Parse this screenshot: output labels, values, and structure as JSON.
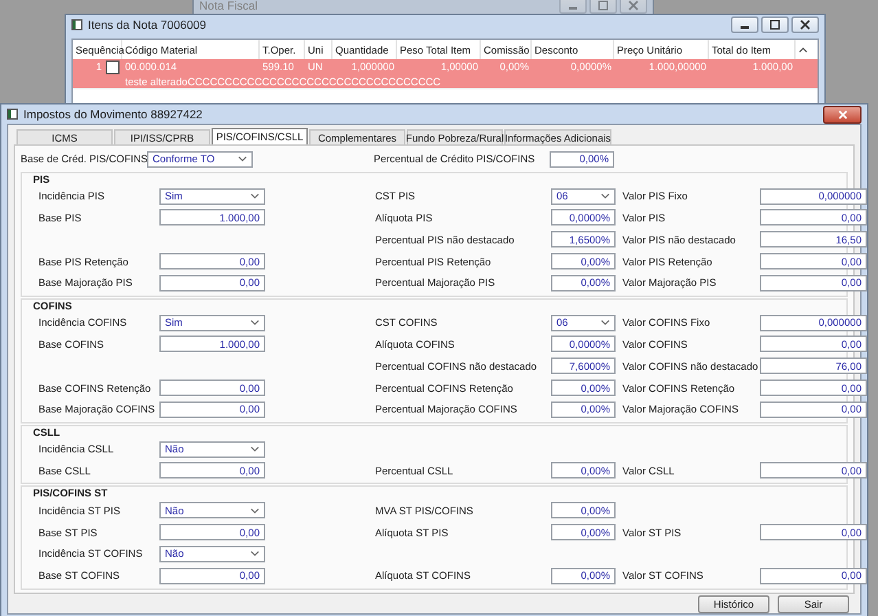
{
  "background_window": {
    "title": "Nota Fiscal"
  },
  "items_window": {
    "title": "Itens da Nota 7006009",
    "columns": [
      "Sequência",
      "Código Material",
      "T.Oper.",
      "Uni",
      "Quantidade",
      "Peso Total Item",
      "Comissão",
      "Desconto",
      "Preço Unitário",
      "Total do Item"
    ],
    "rows": [
      {
        "selected": true,
        "checked": false,
        "cells": [
          "1",
          "00.000.014",
          "599.10",
          "UN",
          "1,000000",
          "1,00000",
          "0,00%",
          "0,0000%",
          "1.000,00000",
          "1.000,00"
        ],
        "description": "teste alteradoCCCCCCCCCCCCCCCCCCCCCCCCCCCCCCCCCC"
      }
    ]
  },
  "taxes_window": {
    "title": "Impostos do Movimento 88927422",
    "tabs": [
      {
        "label": "ICMS",
        "selected": false
      },
      {
        "label": "IPI/ISS/CPRB",
        "selected": false
      },
      {
        "label": "PIS/COFINS/CSLL",
        "selected": true
      },
      {
        "label": "Complementares",
        "selected": false
      },
      {
        "label": "Fundo Pobreza/Rural",
        "selected": false
      },
      {
        "label": "Informações Adicionais",
        "selected": false
      }
    ],
    "sections": [
      {
        "rows": [
          {
            "left": {
              "label": "Base de Créd. PIS/COFINS",
              "value": "Conforme TO",
              "kind": "combo"
            },
            "middle": {
              "label": "Percentual de Crédito PIS/COFINS",
              "value": "0,00%",
              "kind": "text"
            }
          }
        ]
      },
      {
        "title": "PIS",
        "rows": [
          {
            "left": {
              "label": "Incidência PIS",
              "value": "Sim",
              "kind": "combo"
            },
            "middle": {
              "label": "CST PIS",
              "value": "06",
              "kind": "combo"
            },
            "right": {
              "label": "Valor PIS Fixo",
              "value": "0,000000",
              "kind": "text"
            }
          },
          {
            "left": {
              "label": "Base PIS",
              "value": "1.000,00",
              "kind": "text"
            },
            "middle": {
              "label": "Alíquota PIS",
              "value": "0,0000%",
              "kind": "text"
            },
            "right": {
              "label": "Valor PIS",
              "value": "0,00",
              "kind": "text"
            }
          },
          {
            "middle": {
              "label": "Percentual PIS não destacado",
              "value": "1,6500%",
              "kind": "text"
            },
            "right": {
              "label": "Valor PIS não destacado",
              "value": "16,50",
              "kind": "text"
            }
          },
          {
            "left": {
              "label": "Base PIS Retenção",
              "value": "0,00",
              "kind": "text"
            },
            "middle": {
              "label": "Percentual PIS Retenção",
              "value": "0,00%",
              "kind": "text"
            },
            "right": {
              "label": "Valor PIS Retenção",
              "value": "0,00",
              "kind": "text"
            }
          },
          {
            "left": {
              "label": "Base Majoração PIS",
              "value": "0,00",
              "kind": "text"
            },
            "middle": {
              "label": "Percentual Majoração PIS",
              "value": "0,00%",
              "kind": "text"
            },
            "right": {
              "label": "Valor Majoração PIS",
              "value": "0,00",
              "kind": "text"
            }
          }
        ]
      },
      {
        "title": "COFINS",
        "rows": [
          {
            "left": {
              "label": "Incidência COFINS",
              "value": "Sim",
              "kind": "combo"
            },
            "middle": {
              "label": "CST COFINS",
              "value": "06",
              "kind": "combo"
            },
            "right": {
              "label": "Valor COFINS Fixo",
              "value": "0,000000",
              "kind": "text"
            }
          },
          {
            "left": {
              "label": "Base COFINS",
              "value": "1.000,00",
              "kind": "text"
            },
            "middle": {
              "label": "Alíquota COFINS",
              "value": "0,0000%",
              "kind": "text"
            },
            "right": {
              "label": "Valor COFINS",
              "value": "0,00",
              "kind": "text"
            }
          },
          {
            "middle": {
              "label": "Percentual COFINS não destacado",
              "value": "7,6000%",
              "kind": "text"
            },
            "right": {
              "label": "Valor COFINS não destacado",
              "value": "76,00",
              "kind": "text"
            }
          },
          {
            "left": {
              "label": "Base COFINS Retenção",
              "value": "0,00",
              "kind": "text"
            },
            "middle": {
              "label": "Percentual COFINS Retenção",
              "value": "0,00%",
              "kind": "text"
            },
            "right": {
              "label": "Valor COFINS Retenção",
              "value": "0,00",
              "kind": "text"
            }
          },
          {
            "left": {
              "label": "Base Majoração COFINS",
              "value": "0,00",
              "kind": "text"
            },
            "middle": {
              "label": "Percentual Majoração COFINS",
              "value": "0,00%",
              "kind": "text"
            },
            "right": {
              "label": "Valor Majoração COFINS",
              "value": "0,00",
              "kind": "text"
            }
          }
        ]
      },
      {
        "title": "CSLL",
        "rows": [
          {
            "left": {
              "label": "Incidência CSLL",
              "value": "Não",
              "kind": "combo"
            }
          },
          {
            "left": {
              "label": "Base CSLL",
              "value": "0,00",
              "kind": "text"
            },
            "middle": {
              "label": "Percentual CSLL",
              "value": "0,00%",
              "kind": "text"
            },
            "right": {
              "label": "Valor CSLL",
              "value": "0,00",
              "kind": "text"
            }
          }
        ]
      },
      {
        "title": "PIS/COFINS ST",
        "rows": [
          {
            "left": {
              "label": "Incidência ST PIS",
              "value": "Não",
              "kind": "combo"
            },
            "middle": {
              "label": "MVA ST PIS/COFINS",
              "value": "0,00%",
              "kind": "text"
            }
          },
          {
            "left": {
              "label": "Base ST PIS",
              "value": "0,00",
              "kind": "text"
            },
            "middle": {
              "label": "Alíquota ST PIS",
              "value": "0,00%",
              "kind": "text"
            },
            "right": {
              "label": "Valor ST PIS",
              "value": "0,00",
              "kind": "text"
            }
          },
          {
            "left": {
              "label": "Incidência ST COFINS",
              "value": "Não",
              "kind": "combo"
            }
          },
          {
            "left": {
              "label": "Base ST COFINS",
              "value": "0,00",
              "kind": "text"
            },
            "middle": {
              "label": "Alíquota ST COFINS",
              "value": "0,00%",
              "kind": "text"
            },
            "right": {
              "label": "Valor ST COFINS",
              "value": "0,00",
              "kind": "text"
            }
          }
        ]
      }
    ],
    "buttons": [
      "Histórico",
      "Sair"
    ]
  }
}
